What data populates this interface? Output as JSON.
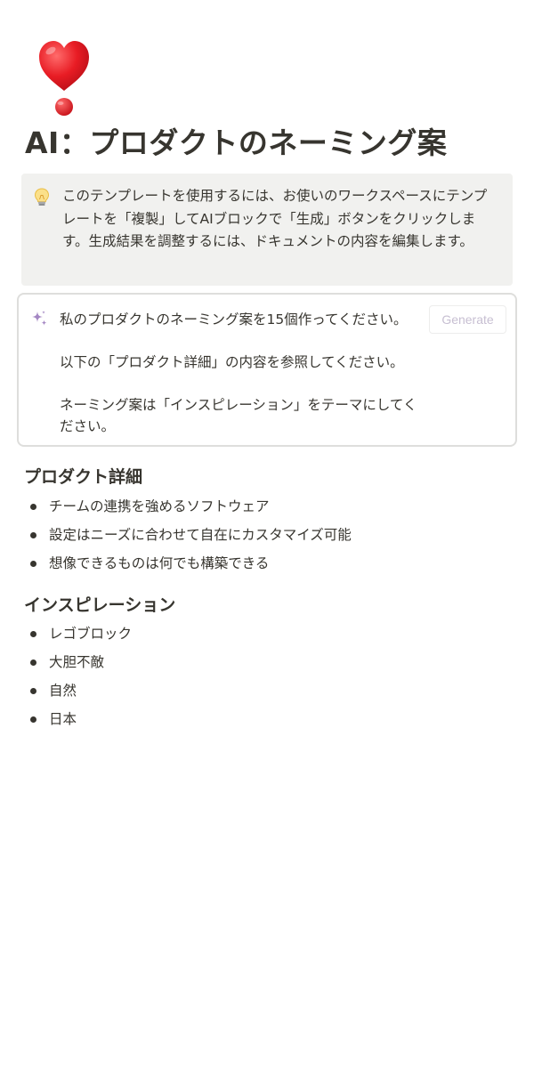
{
  "page": {
    "icon": "heavy-heart-exclamation-icon",
    "title": "AI：プロダクトのネーミング案"
  },
  "callout": {
    "icon": "lightbulb-icon",
    "text": "このテンプレートを使用するには、お使いのワークスペースにテンプレートを「複製」してAIブロックで「生成」ボタンをクリックします。生成結果を調整するには、ドキュメントの内容を編集します。"
  },
  "ai_block": {
    "icon": "sparkle-icon",
    "prompt_lines": [
      "私のプロダクトのネーミング案を15個作ってください。",
      "以下の「プロダクト詳細」の内容を参照してください。",
      "ネーミング案は「インスピレーション」をテーマにしてください。"
    ],
    "generate_label": "Generate"
  },
  "sections": [
    {
      "heading": "プロダクト詳細",
      "items": [
        "チームの連携を強めるソフトウェア",
        "設定はニーズに合わせて自在にカスタマイズ可能",
        "想像できるものは何でも構築できる"
      ]
    },
    {
      "heading": "インスピレーション",
      "items": [
        "レゴブロック",
        "大胆不敵",
        "自然",
        "日本"
      ]
    }
  ],
  "colors": {
    "text": "#37352f",
    "callout_bg": "#f1f1ef",
    "ai_border": "#dededc",
    "sparkle": "#a487c3",
    "generate_text": "#c7bfd2",
    "heart": "#e0242c"
  }
}
